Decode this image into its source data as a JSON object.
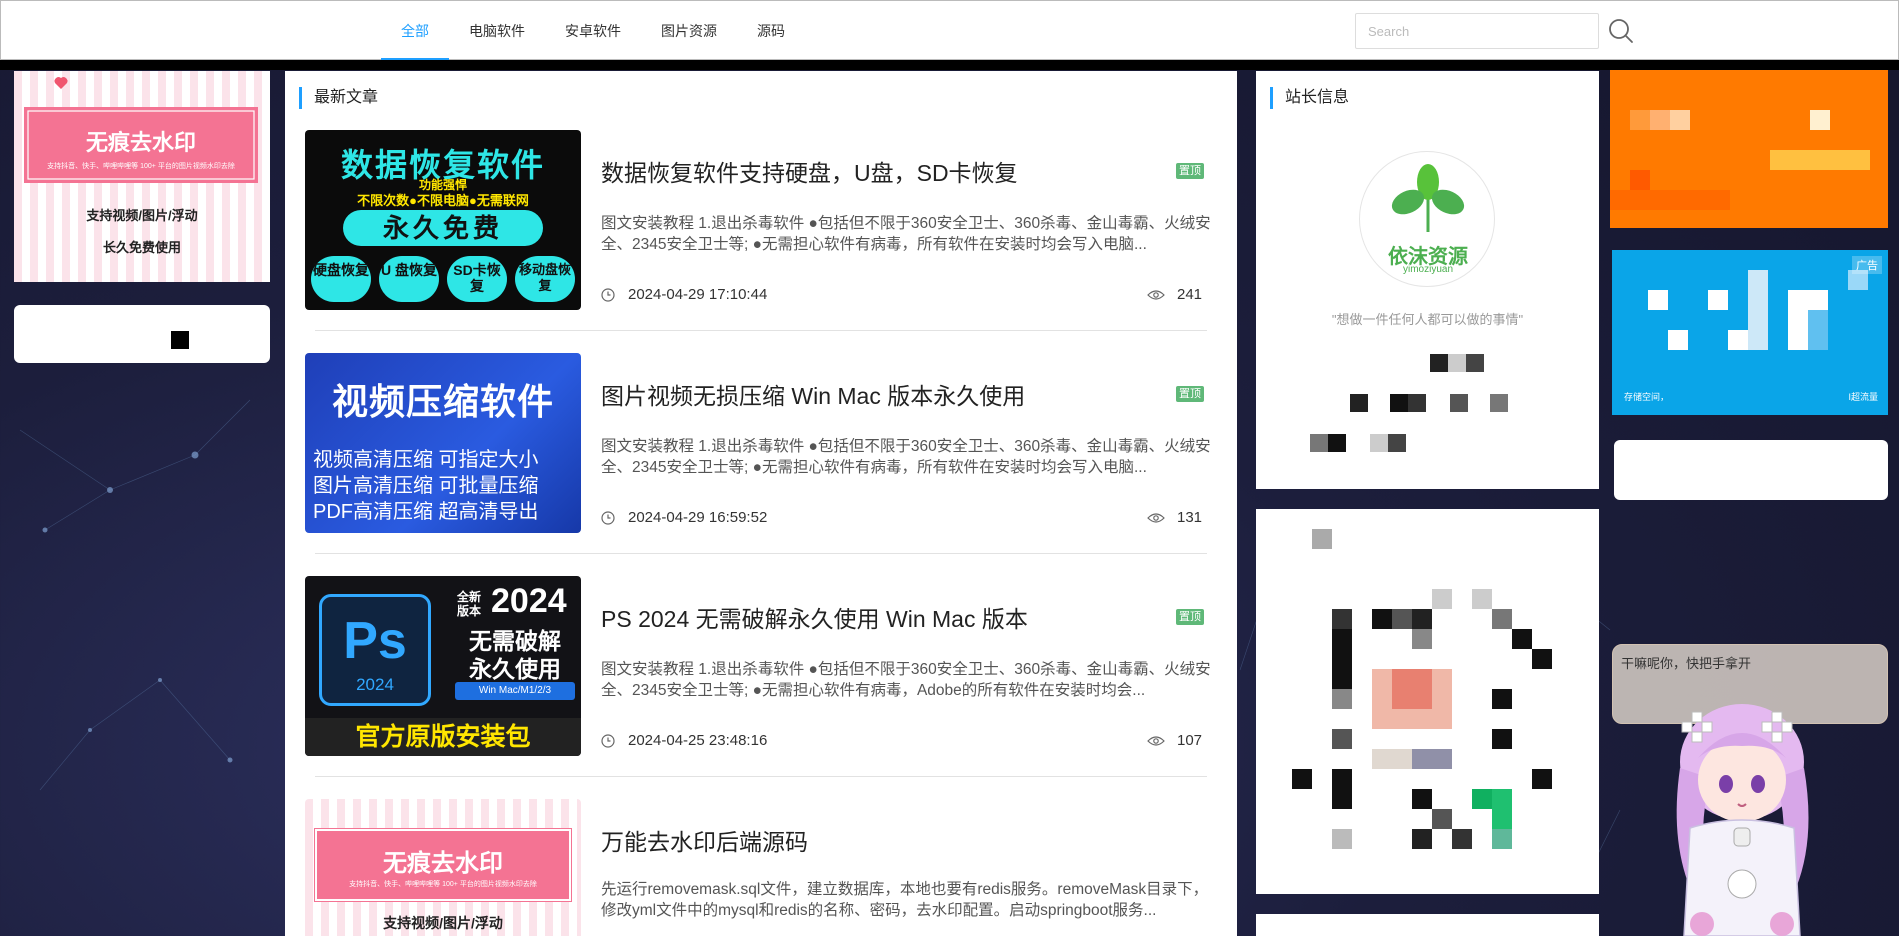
{
  "nav": {
    "items": [
      "全部",
      "电脑软件",
      "安卓软件",
      "图片资源",
      "源码"
    ],
    "active_index": 0
  },
  "search": {
    "placeholder": "Search"
  },
  "main": {
    "section_title": "最新文章",
    "badge_label": "置顶",
    "articles": [
      {
        "title": "数据恢复软件支持硬盘，U盘，SD卡恢复",
        "thumb_lines": [
          "数据恢复软件",
          "功能强悍",
          "不限次数●不限电脑●无需联网",
          "永久免费",
          "硬盘恢复",
          "U 盘恢复",
          "SD卡恢复",
          "移动盘恢复"
        ],
        "summary": "图文安装教程 1.退出杀毒软件 ●包括但不限于360安全卫士、360杀毒、金山毒霸、火绒安全、2345安全卫士等; ●无需担心软件有病毒，所有软件在安装时均会写入电脑...",
        "date": "2024-04-29 17:10:44",
        "views": "241",
        "pinned": true
      },
      {
        "title": "图片视频无损压缩 Win Mac 版本永久使用",
        "thumb_lines": [
          "视频压缩软件",
          "视频高清压缩 可指定大小",
          "图片高清压缩 可批量压缩",
          "PDF高清压缩 超高清导出"
        ],
        "summary": "图文安装教程 1.退出杀毒软件 ●包括但不限于360安全卫士、360杀毒、金山毒霸、火绒安全、2345安全卫士等; ●无需担心软件有病毒，所有软件在安装时均会写入电脑...",
        "date": "2024-04-29 16:59:52",
        "views": "131",
        "pinned": true
      },
      {
        "title": "PS 2024 无需破解永久使用 Win Mac 版本",
        "thumb_lines": [
          "Ps",
          "2024",
          "全新版本",
          "2024",
          "无需破解",
          "永久使用",
          "Win  Mac/M1/2/3",
          "官方原版安装包"
        ],
        "summary": "图文安装教程 1.退出杀毒软件 ●包括但不限于360安全卫士、360杀毒、金山毒霸、火绒安全、2345安全卫士等; ●无需担心软件有病毒，Adobe的所有软件在安装时均会...",
        "date": "2024-04-25 23:48:16",
        "views": "107",
        "pinned": true
      },
      {
        "title": "万能去水印后端源码",
        "thumb_lines": [
          "无痕去水印",
          "支持抖音、快手、哔哩哔哩等 100+ 平台的图片视频水印去除",
          "支持视频/图片/浮动"
        ],
        "summary": "先运行removemask.sql文件，建立数据库，本地也要有redis服务。removeMask目录下，修改yml文件中的mysql和redis的名称、密码，去水印配置。启动springboot服务...",
        "date": "",
        "views": "",
        "pinned": false
      }
    ]
  },
  "left_ad": {
    "title": "无痕去水印",
    "subtitle": "支持抖音、快手、哔哩哔哩等 100+ 平台的图片视频水印去除",
    "line1": "支持视频/图片/浮动",
    "line2": "长久免费使用"
  },
  "owner": {
    "title": "站长信息",
    "logo_text": "依沫资源",
    "logo_sub": "yimoziyuan",
    "motto": "\"想做一件任何人都可以做的事情\""
  },
  "right_ads": {
    "tag": "广告",
    "blue_bottom_left": "存储空间，",
    "blue_bottom_right": "I​超流量"
  },
  "mascot": {
    "speech": "干嘛呢你，快把手拿开"
  },
  "colors": {
    "accent": "#1e9fff",
    "badge": "#5fb878",
    "ad_orange": "#ff7a00",
    "ad_blue": "#0aa5e8"
  }
}
